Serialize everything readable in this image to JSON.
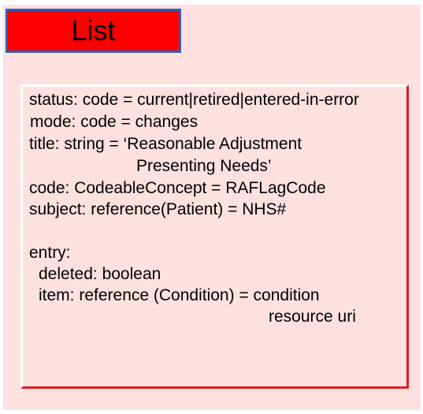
{
  "header": {
    "title": "List"
  },
  "fields": {
    "status": "status: code = current|retired|entered-in-error",
    "mode": "mode: code = changes",
    "title_line1": "title: string = ‘Reasonable Adjustment",
    "title_line2": "Presenting Needs’",
    "code": "code: CodeableConcept = RAFLagCode",
    "subject": "subject: reference(Patient) = NHS#",
    "entry": "entry:",
    "deleted": "deleted: boolean",
    "item_line1": "item: reference (Condition) = condition",
    "item_line2": "resource uri"
  },
  "colors": {
    "title_fill": "#ff0000",
    "title_border": "#2e5fb5",
    "panel_fill": "#fde0e0",
    "inner_border": "#e31b1b"
  }
}
